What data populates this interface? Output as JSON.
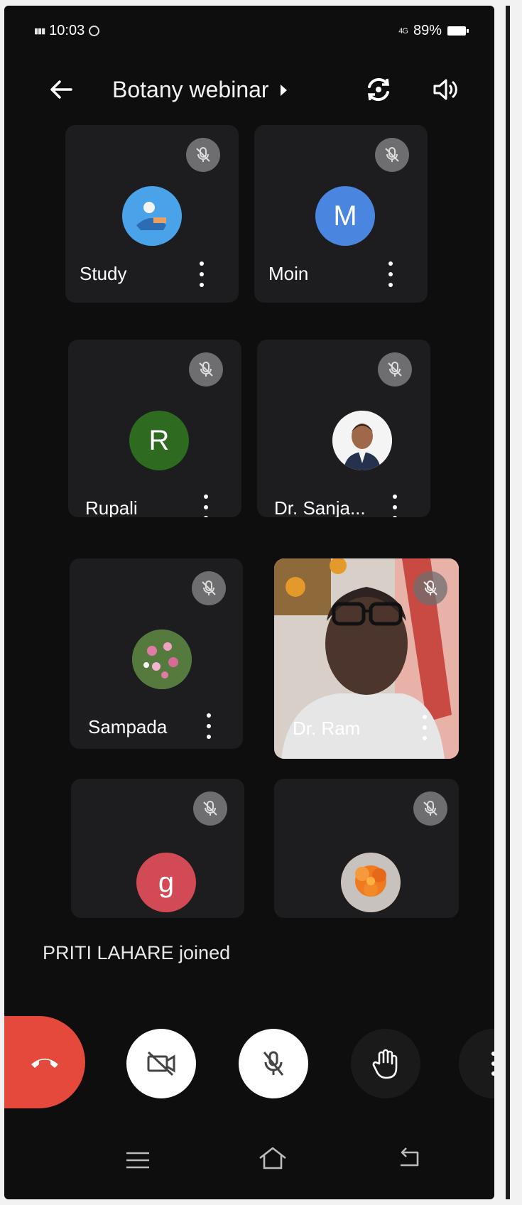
{
  "status_bar": {
    "time": "10:03",
    "signal_text": "4G",
    "battery": "89%"
  },
  "header": {
    "title": "Botany webinar"
  },
  "participants": [
    {
      "name": "Study",
      "avatar_letter": "",
      "avatar_color": "#2f8fd6"
    },
    {
      "name": "Moin",
      "avatar_letter": "M",
      "avatar_color": "#4a86e0"
    },
    {
      "name": "Rupali",
      "avatar_letter": "R",
      "avatar_color": "#2e6a1f"
    },
    {
      "name": "Dr. Sanja...",
      "avatar_letter": "",
      "avatar_color": "#f3f3f3"
    },
    {
      "name": "Sampada",
      "avatar_letter": "",
      "avatar_color": "#6f8a55"
    },
    {
      "name": "Dr. Ram",
      "avatar_letter": "",
      "avatar_color": "#8a6b5a"
    },
    {
      "name": "",
      "avatar_letter": "g",
      "avatar_color": "#d24a55"
    },
    {
      "name": "",
      "avatar_letter": "",
      "avatar_color": "#e8732a"
    }
  ],
  "toast": {
    "text": "PRITI LAHARE joined"
  },
  "controls": {
    "end_call_color": "#e4493b",
    "camera_off_bg": "#ffffff",
    "mic_off_bg": "#ffffff",
    "raise_hand_bg": "#1a1a1b",
    "more_bg": "#1a1a1b"
  }
}
